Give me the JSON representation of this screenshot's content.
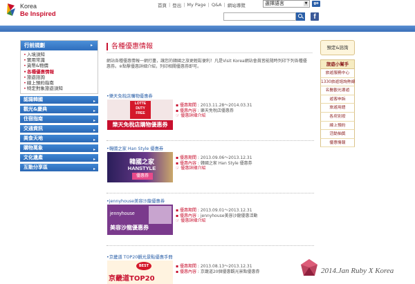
{
  "header": {
    "logo_line1": "Korea",
    "logo_line2": "Be Inspired",
    "topnav": [
      "首頁",
      "登出",
      "My Page",
      "Q&A",
      "網站導覽"
    ],
    "language_select": "選擇語言",
    "go_label": "go",
    "search_placeholder": ""
  },
  "sidebar": {
    "title": "行前規劃",
    "sub_items": [
      {
        "label": "入境須知",
        "active": false
      },
      {
        "label": "實用常識",
        "active": false
      },
      {
        "label": "貨幣&物價",
        "active": false
      },
      {
        "label": "各種優惠情報",
        "active": true
      },
      {
        "label": "旅遊諮詢",
        "active": false
      },
      {
        "label": "線上預約指南",
        "active": false
      },
      {
        "label": "特定對象旅遊須知",
        "active": false
      }
    ],
    "categories": [
      "認識韓國",
      "觀光&慶典",
      "住宿指南",
      "交通資訊",
      "美食天地",
      "購物萬象",
      "文化遺產",
      "互動分享區"
    ]
  },
  "main": {
    "title": "各種優惠情報",
    "intro": "網站各種優惠情報一網打盡，讓您的韓國之旅更輕鬆便利！凡是Visit Korea網站會員皆能隨時列印下列各種優惠券。※點擊優惠詳細介紹，列印相關優惠券即可。",
    "period_label": "優惠期間",
    "content_label": "優惠內容",
    "detail_link": "優惠詳細介紹",
    "coupons": [
      {
        "title": "樂天免稅店購物優惠券",
        "image_text_1": "LOTTE",
        "image_text_2": "DUTY",
        "image_text_3": "FREE",
        "banner": "樂天免稅店購物優惠券",
        "period": "2013.11.28～2014.03.31",
        "content": "樂天免稅店優惠券"
      },
      {
        "title": "韓國之家 Han Style 優惠券",
        "image_text_1": "韓國之家",
        "image_text_2": "HANSTYLE",
        "banner": "優惠券",
        "period": "2013.09.06～2013.12.31",
        "content": "韓國之家 Han Style 優惠券"
      },
      {
        "title": "jennyhouse美容沙龍優惠券",
        "image_text_1": "jennyhouse",
        "banner": "美容沙龍優惠券",
        "period": "2013.09.01～2013.12.31",
        "content": "jennyhouse美容沙龍優惠活動"
      },
      {
        "title": "京畿道 TOP20觀光景點優惠手冊",
        "image_text_1": "BEST",
        "banner": "京畿道TOP20",
        "period": "2013.08.13～2013.12.31",
        "content": "京畿道20個優惠觀光景點優惠券"
      }
    ]
  },
  "right_sidebar": {
    "top_box": "預定&諮詢",
    "header": "旅遊小幫手",
    "items": [
      "旅遊服務中心",
      "1330旅遊諮詢熱線",
      "名醫觀光導遊",
      "遊客申訴",
      "旅遊用語",
      "各府別按",
      "線上預約",
      "活動抽獎",
      "優惠情報"
    ]
  },
  "watermark": "2014.Jan Ruby X Korea",
  "colors": {
    "accent_red": "#c8102e",
    "nav_blue": "#2f6ebd",
    "link_blue": "#2a5fa8"
  }
}
